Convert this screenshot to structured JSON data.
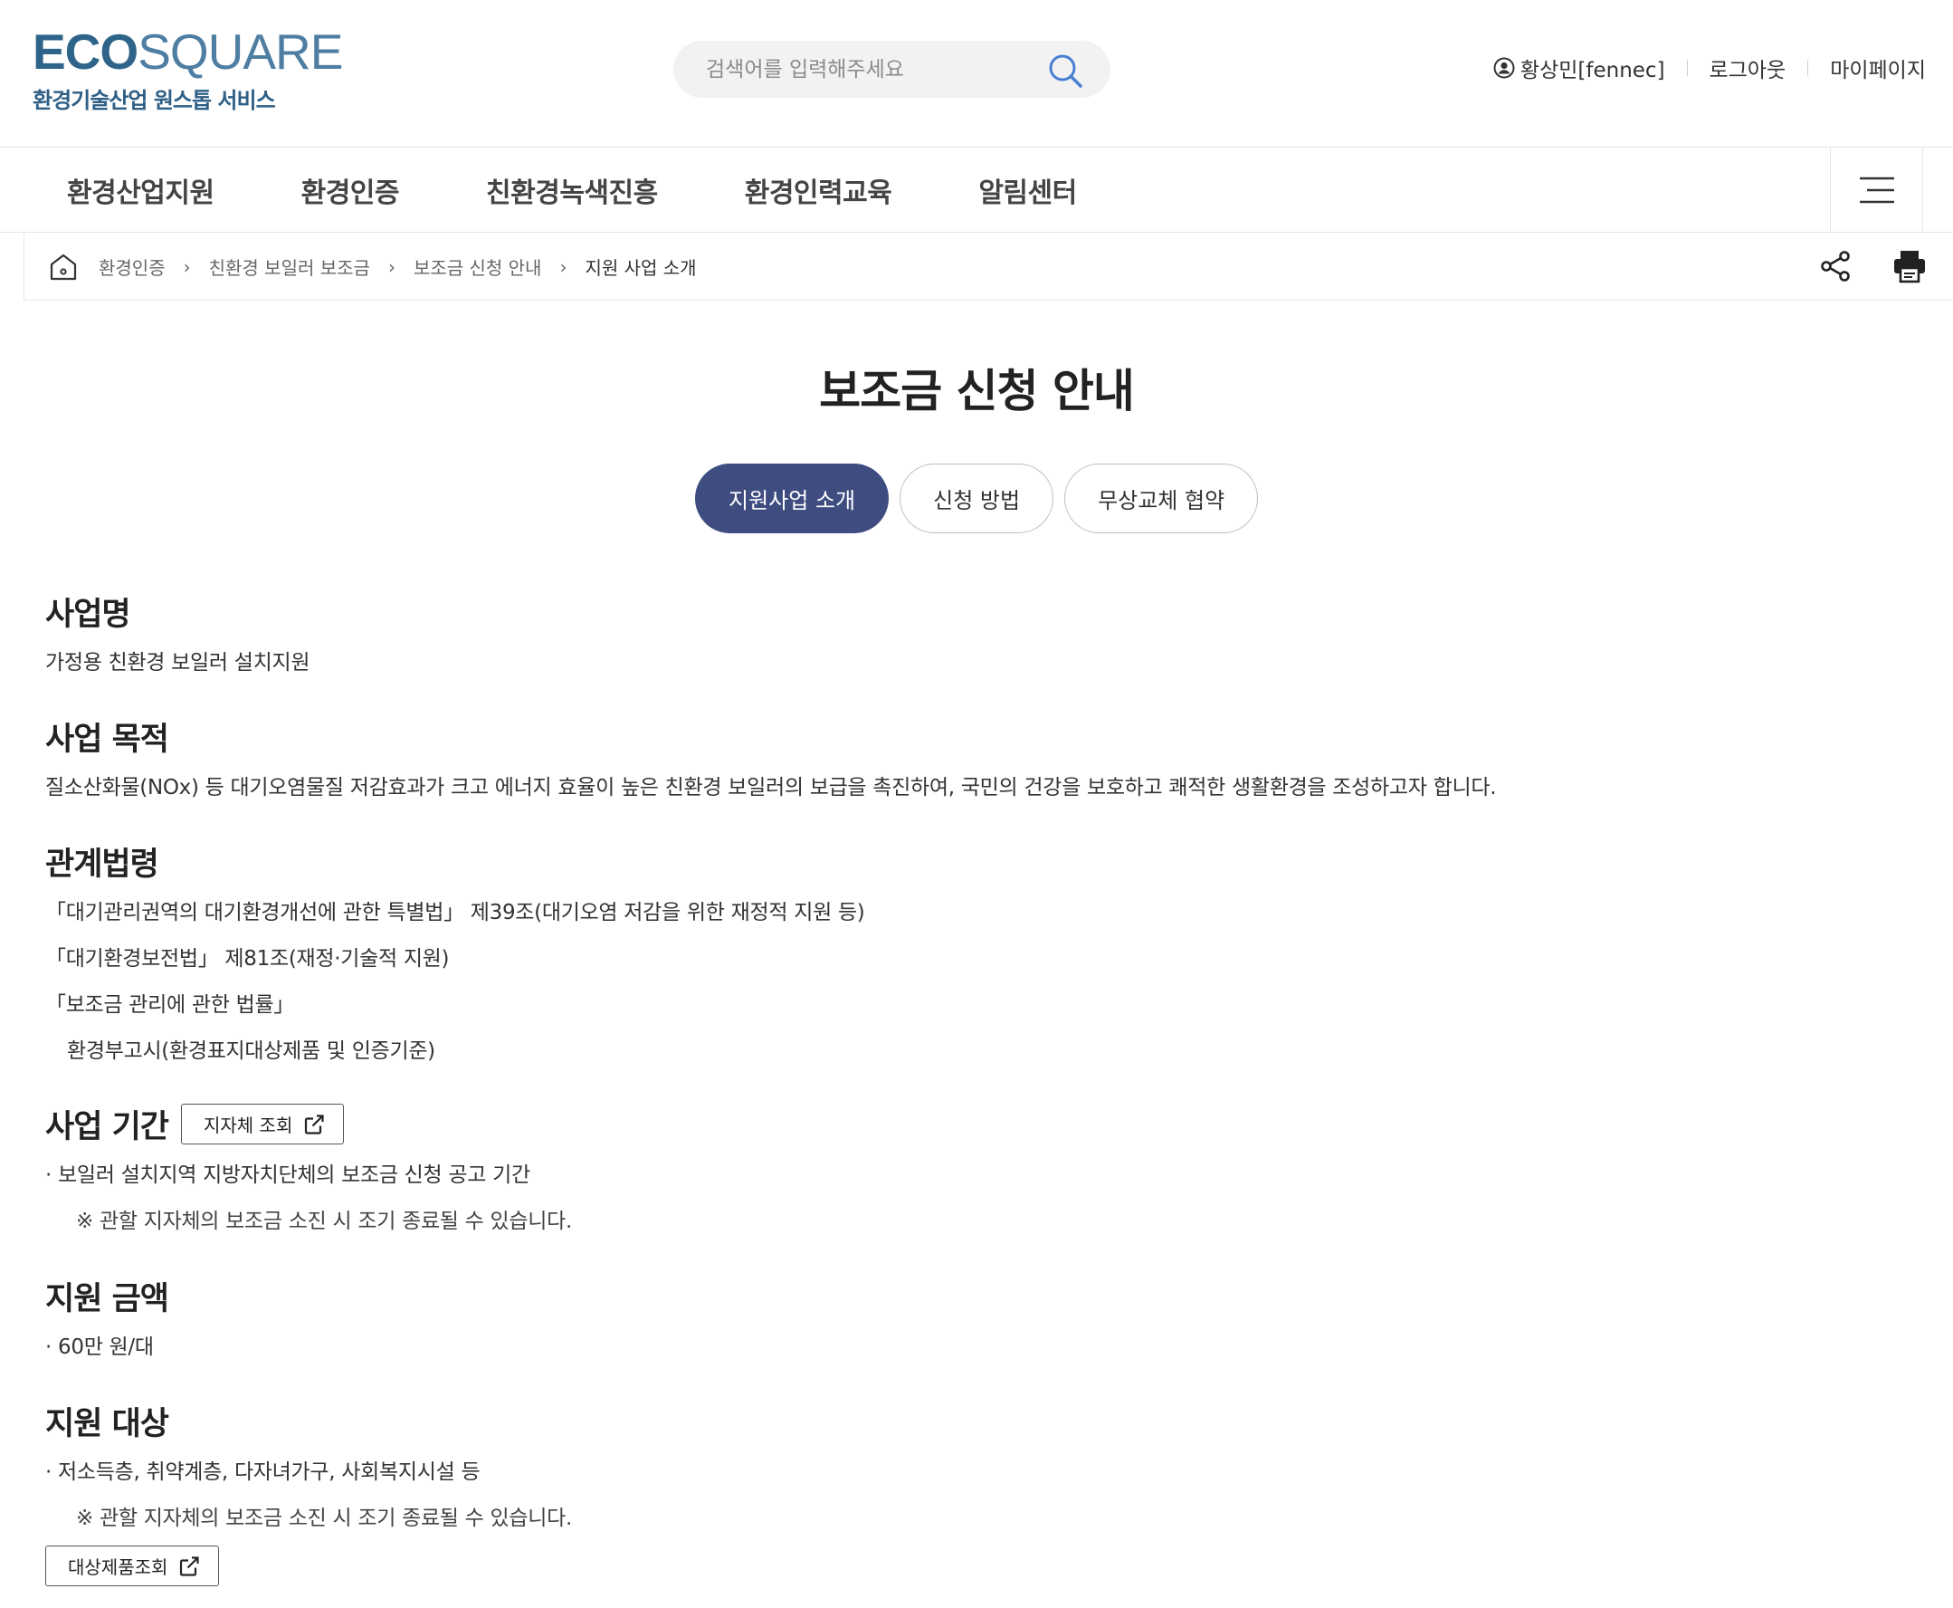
{
  "header": {
    "logo_bold": "ECO",
    "logo_light": "SQUARE",
    "logo_sub": "환경기술산업 원스톱 서비스",
    "search_placeholder": "검색어를 입력해주세요",
    "user_name": "황상민[fennec]",
    "logout": "로그아웃",
    "mypage": "마이페이지"
  },
  "gnb": {
    "items": [
      "환경산업지원",
      "환경인증",
      "친환경녹색진흥",
      "환경인력교육",
      "알림센터"
    ]
  },
  "breadcrumb": {
    "items": [
      "환경인증",
      "친환경 보일러 보조금",
      "보조금 신청 안내"
    ],
    "current": "지원 사업 소개"
  },
  "page": {
    "title": "보조금 신청 안내",
    "tabs": [
      "지원사업 소개",
      "신청 방법",
      "무상교체 협약"
    ],
    "active_tab": 0
  },
  "sections": {
    "name": {
      "title": "사업명",
      "text": "가정용 친환경 보일러 설치지원"
    },
    "purpose": {
      "title": "사업 목적",
      "text": "질소산화물(NOx) 등 대기오염물질 저감효과가 크고 에너지 효율이 높은 친환경 보일러의 보급을 촉진하여, 국민의 건강을 보호하고 쾌적한 생활환경을 조성하고자 합니다."
    },
    "laws": {
      "title": "관계법령",
      "lines": [
        "「대기관리권역의 대기환경개선에 관한 특별법」 제39조(대기오염 저감을 위한 재정적 지원 등)",
        "「대기환경보전법」 제81조(재정·기술적 지원)",
        "「보조금 관리에 관한 법률」",
        "환경부고시(환경표지대상제품 및 인증기준)"
      ]
    },
    "period": {
      "title": "사업 기간",
      "button": "지자체 조회",
      "line": "· 보일러 설치지역 지방자치단체의 보조금 신청 공고 기간",
      "note": "※ 관할 지자체의 보조금 소진 시 조기 종료될 수 있습니다."
    },
    "amount": {
      "title": "지원 금액",
      "line": "· 60만 원/대"
    },
    "target": {
      "title": "지원 대상",
      "line": "· 저소득층, 취약계층, 다자녀가구, 사회복지시설 등",
      "note": "※ 관할 지자체의 보조금 소진 시 조기 종료될 수 있습니다.",
      "button": "대상제품조회"
    }
  },
  "colors": {
    "accent": "#3e4c80",
    "logo": "#2e6489",
    "search_icon": "#4a7fd6"
  },
  "icons": {
    "user": "user-circle-icon",
    "search": "search-icon",
    "menu": "hamburger-menu-icon",
    "home": "home-icon",
    "share": "share-icon",
    "print": "print-icon",
    "external": "external-link-icon"
  }
}
